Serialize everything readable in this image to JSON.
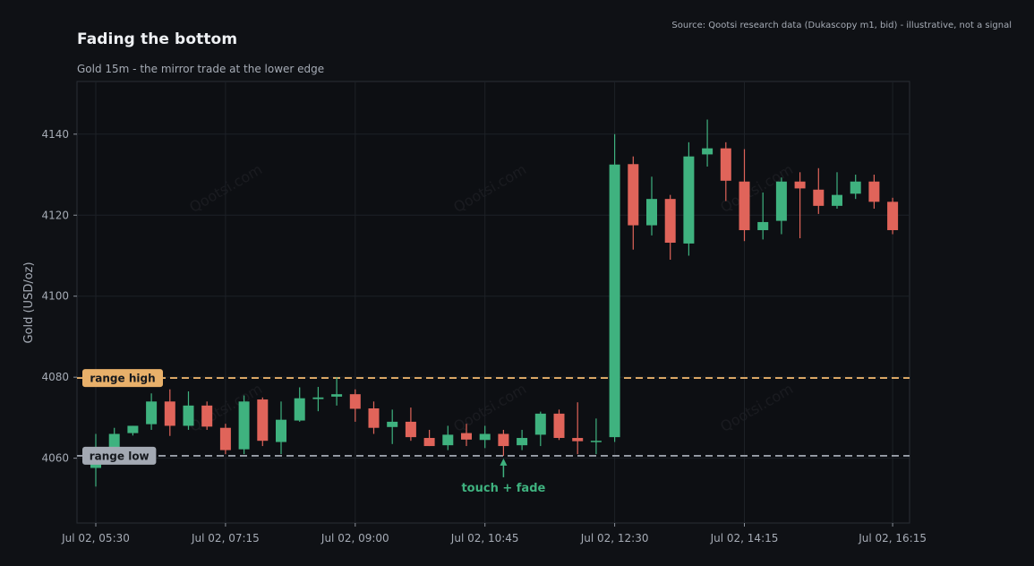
{
  "title": "Fading the bottom",
  "subtitle": "Gold 15m - the mirror trade at the lower edge",
  "source": "Source: Qootsi research data (Dukascopy m1, bid) - illustrative, not a signal",
  "watermark": "Qootsi.com",
  "colors": {
    "background": "#0f1115",
    "plot_background": "#0d0f13",
    "up": "#3fb27f",
    "down": "#e0645a",
    "range_high": "#e8b06a",
    "range_low": "#9aa0aa",
    "annotation": "#3fb27f"
  },
  "chart_data": {
    "type": "candlestick",
    "ylabel": "Gold (USD/oz)",
    "xlabel": "",
    "ylim": [
      4044,
      4153
    ],
    "yticks": [
      4060,
      4080,
      4100,
      4120,
      4140
    ],
    "xticks": [
      {
        "label": "Jul 02, 05:30",
        "index": 0
      },
      {
        "label": "Jul 02, 07:15",
        "index": 7
      },
      {
        "label": "Jul 02, 09:00",
        "index": 14
      },
      {
        "label": "Jul 02, 10:45",
        "index": 21
      },
      {
        "label": "Jul 02, 12:30",
        "index": 28
      },
      {
        "label": "Jul 02, 14:15",
        "index": 35
      },
      {
        "label": "Jul 02, 16:15",
        "index": 43
      }
    ],
    "grid": true,
    "range_high": {
      "value": 4079.8,
      "label": "range high"
    },
    "range_low": {
      "value": 4060.6,
      "label": "range low"
    },
    "annotation": {
      "label": "touch + fade",
      "index": 22,
      "y": 4060.6
    },
    "candles": [
      {
        "o": 4057.6,
        "h": 4066.0,
        "l": 4053.0,
        "c": 4058.5
      },
      {
        "o": 4061.0,
        "h": 4067.5,
        "l": 4060.0,
        "c": 4066.0
      },
      {
        "o": 4066.2,
        "h": 4068.0,
        "l": 4065.6,
        "c": 4068.0
      },
      {
        "o": 4068.4,
        "h": 4076.0,
        "l": 4067.0,
        "c": 4074.0
      },
      {
        "o": 4074.0,
        "h": 4077.0,
        "l": 4065.5,
        "c": 4068.0
      },
      {
        "o": 4068.0,
        "h": 4076.5,
        "l": 4067.0,
        "c": 4073.0
      },
      {
        "o": 4073.0,
        "h": 4074.0,
        "l": 4067.0,
        "c": 4067.8
      },
      {
        "o": 4067.5,
        "h": 4068.5,
        "l": 4061.0,
        "c": 4062.0
      },
      {
        "o": 4062.2,
        "h": 4075.5,
        "l": 4061.0,
        "c": 4074.0
      },
      {
        "o": 4074.5,
        "h": 4075.0,
        "l": 4063.0,
        "c": 4064.3
      },
      {
        "o": 4064.0,
        "h": 4074.0,
        "l": 4061.0,
        "c": 4069.5
      },
      {
        "o": 4069.3,
        "h": 4077.5,
        "l": 4069.0,
        "c": 4074.8
      },
      {
        "o": 4074.6,
        "h": 4077.6,
        "l": 4071.6,
        "c": 4075.0
      },
      {
        "o": 4075.2,
        "h": 4080.0,
        "l": 4073.0,
        "c": 4075.8
      },
      {
        "o": 4075.8,
        "h": 4077.0,
        "l": 4069.0,
        "c": 4072.2
      },
      {
        "o": 4072.3,
        "h": 4074.0,
        "l": 4066.0,
        "c": 4067.5
      },
      {
        "o": 4067.7,
        "h": 4072.0,
        "l": 4063.5,
        "c": 4069.0
      },
      {
        "o": 4069.0,
        "h": 4072.5,
        "l": 4064.3,
        "c": 4065.2
      },
      {
        "o": 4065.0,
        "h": 4067.0,
        "l": 4063.0,
        "c": 4063.0
      },
      {
        "o": 4063.2,
        "h": 4068.0,
        "l": 4062.0,
        "c": 4065.8
      },
      {
        "o": 4066.2,
        "h": 4068.5,
        "l": 4063.0,
        "c": 4064.6
      },
      {
        "o": 4064.5,
        "h": 4068.0,
        "l": 4062.5,
        "c": 4066.0
      },
      {
        "o": 4066.0,
        "h": 4067.0,
        "l": 4060.6,
        "c": 4063.0
      },
      {
        "o": 4063.2,
        "h": 4067.0,
        "l": 4062.0,
        "c": 4065.0
      },
      {
        "o": 4065.8,
        "h": 4071.5,
        "l": 4063.0,
        "c": 4071.0
      },
      {
        "o": 4071.0,
        "h": 4072.0,
        "l": 4064.5,
        "c": 4065.0
      },
      {
        "o": 4065.0,
        "h": 4073.8,
        "l": 4061.0,
        "c": 4064.2
      },
      {
        "o": 4064.2,
        "h": 4069.8,
        "l": 4061.0,
        "c": 4064.3
      },
      {
        "o": 4065.2,
        "h": 4140.0,
        "l": 4064.0,
        "c": 4132.5
      },
      {
        "o": 4132.6,
        "h": 4134.5,
        "l": 4111.5,
        "c": 4117.5
      },
      {
        "o": 4117.5,
        "h": 4129.5,
        "l": 4115.0,
        "c": 4124.0
      },
      {
        "o": 4124.0,
        "h": 4125.0,
        "l": 4109.0,
        "c": 4113.2
      },
      {
        "o": 4113.0,
        "h": 4138.0,
        "l": 4110.0,
        "c": 4134.5
      },
      {
        "o": 4135.0,
        "h": 4143.6,
        "l": 4132.0,
        "c": 4136.5
      },
      {
        "o": 4136.5,
        "h": 4138.0,
        "l": 4123.5,
        "c": 4128.5
      },
      {
        "o": 4128.3,
        "h": 4136.3,
        "l": 4113.6,
        "c": 4116.3
      },
      {
        "o": 4116.3,
        "h": 4125.6,
        "l": 4114.0,
        "c": 4118.3
      },
      {
        "o": 4118.6,
        "h": 4129.3,
        "l": 4115.3,
        "c": 4128.3
      },
      {
        "o": 4128.3,
        "h": 4130.6,
        "l": 4114.3,
        "c": 4126.6
      },
      {
        "o": 4126.3,
        "h": 4131.6,
        "l": 4120.3,
        "c": 4122.3
      },
      {
        "o": 4122.3,
        "h": 4130.6,
        "l": 4121.6,
        "c": 4125.0
      },
      {
        "o": 4125.3,
        "h": 4130.0,
        "l": 4124.0,
        "c": 4128.3
      },
      {
        "o": 4128.3,
        "h": 4130.0,
        "l": 4121.6,
        "c": 4123.3
      },
      {
        "o": 4123.3,
        "h": 4124.3,
        "l": 4115.3,
        "c": 4116.3
      }
    ]
  }
}
